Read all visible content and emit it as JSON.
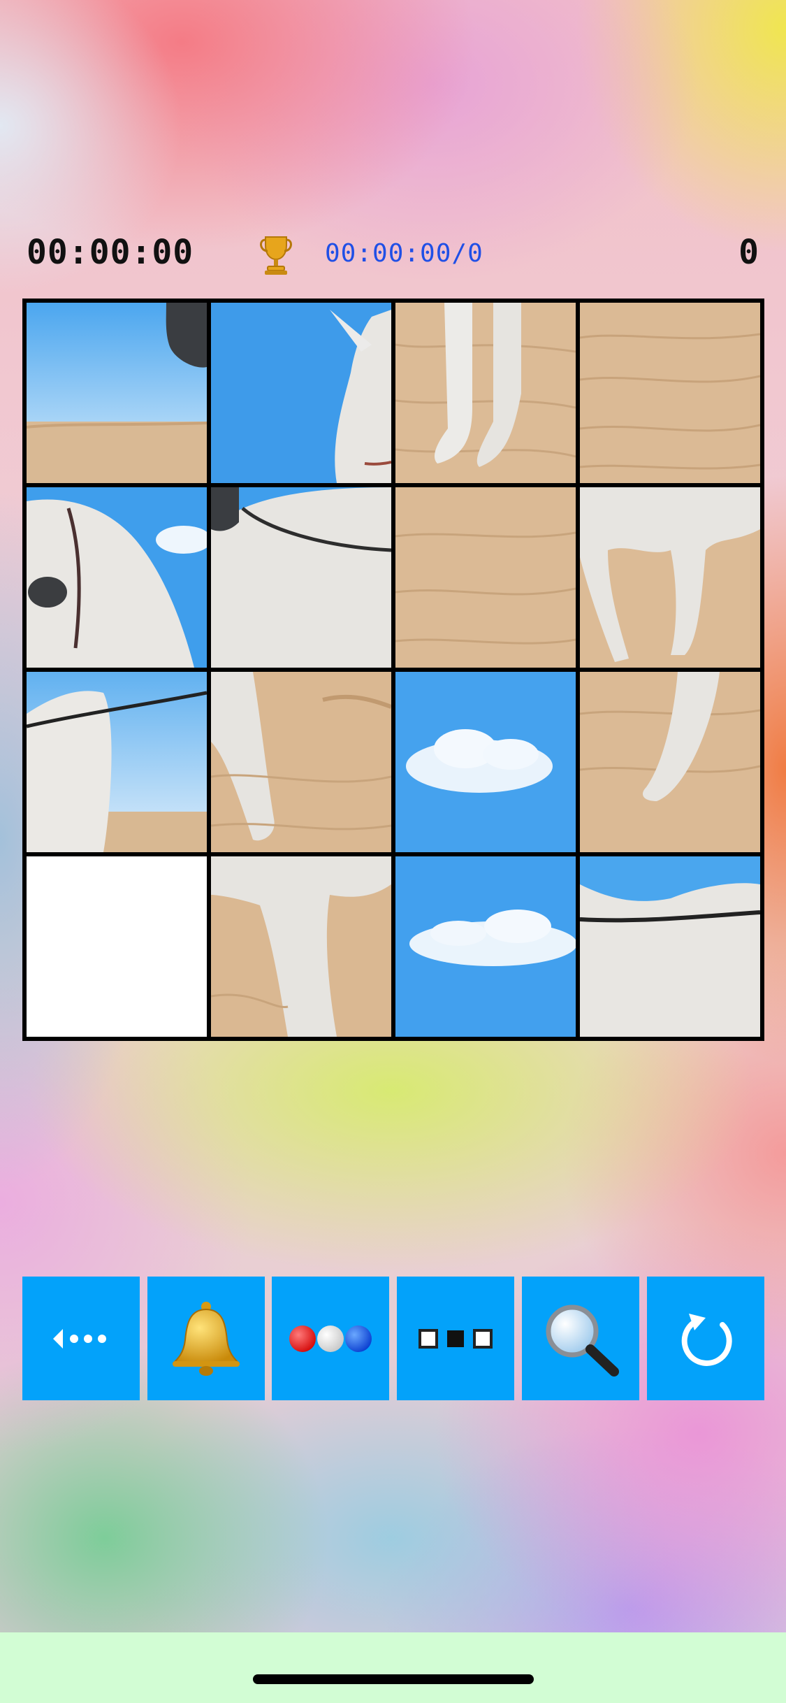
{
  "hud": {
    "timer": "00:00:00",
    "best_record": "00:00:00/0",
    "moves": "0",
    "trophy_icon": "trophy-icon"
  },
  "board": {
    "rows": 4,
    "cols": 4,
    "empty_tile": {
      "row": 4,
      "col": 1
    },
    "tiles": [
      "sky-sand-horse-nose",
      "sky-horse-ear",
      "sand-horse-legs",
      "sand",
      "horse-head-bridle",
      "horse-neck-reins",
      "sand",
      "horse-hind-legs",
      "horse-back-rein",
      "horse-front-leg",
      "sky-cloud",
      "horse-hoof-sand",
      "empty",
      "horse-belly-legs",
      "sky-cloud",
      "horse-back-sky"
    ]
  },
  "toolbar": {
    "buttons": [
      {
        "name": "back-button",
        "icon": "back-dots-icon"
      },
      {
        "name": "sound-button",
        "icon": "bell-icon"
      },
      {
        "name": "colors-button",
        "icon": "color-dots-icon"
      },
      {
        "name": "grid-size-button",
        "icon": "squares-icon"
      },
      {
        "name": "preview-button",
        "icon": "magnifier-icon"
      },
      {
        "name": "restart-button",
        "icon": "refresh-icon"
      }
    ]
  },
  "colors": {
    "button_blue": "#03a2fa",
    "best_text": "#1f4fe6",
    "sky": "#45a2ee",
    "sand": "#dcbb96",
    "bottom_bar": "#d2fdd4"
  }
}
